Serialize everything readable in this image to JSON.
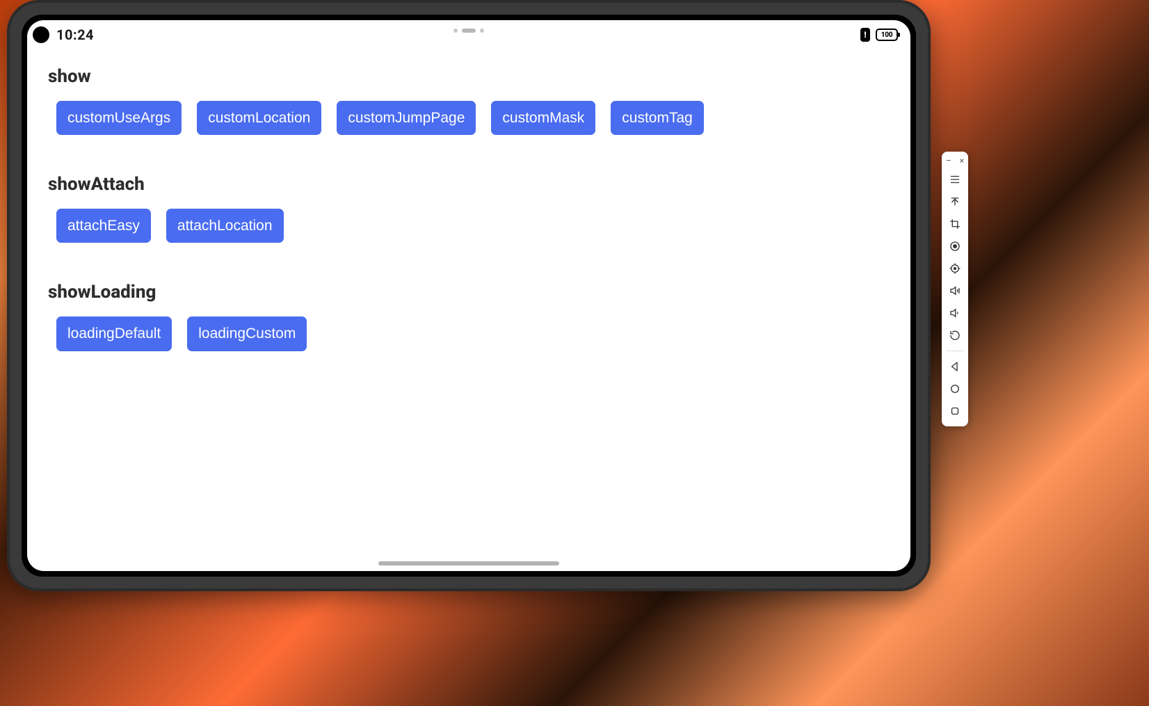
{
  "status": {
    "time": "10:24",
    "battery_level": "100"
  },
  "sections": [
    {
      "title": "show",
      "buttons": [
        "customUseArgs",
        "customLocation",
        "customJumpPage",
        "customMask",
        "customTag"
      ]
    },
    {
      "title": "showAttach",
      "buttons": [
        "attachEasy",
        "attachLocation"
      ]
    },
    {
      "title": "showLoading",
      "buttons": [
        "loadingDefault",
        "loadingCustom"
      ]
    }
  ],
  "emulator_toolbar": {
    "minimize": "–",
    "close": "×",
    "items": [
      {
        "name": "menu"
      },
      {
        "name": "upload-screenshot"
      },
      {
        "name": "crop"
      },
      {
        "name": "record"
      },
      {
        "name": "location-pin"
      },
      {
        "name": "volume-up"
      },
      {
        "name": "volume-down"
      },
      {
        "name": "rotate"
      }
    ],
    "nav": [
      {
        "name": "back"
      },
      {
        "name": "home"
      },
      {
        "name": "overview"
      }
    ]
  }
}
